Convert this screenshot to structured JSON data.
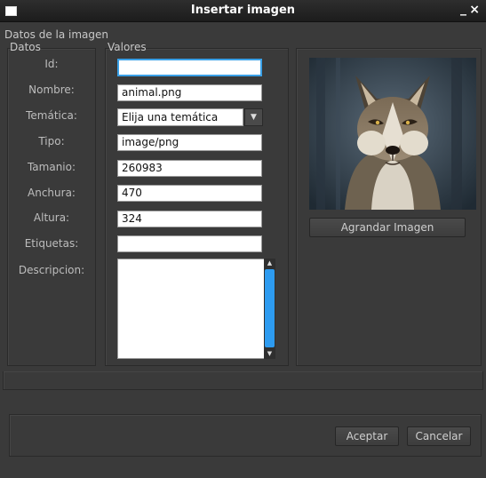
{
  "window": {
    "title": "Insertar imagen",
    "minimize_glyph": "_",
    "close_glyph": "×"
  },
  "group": {
    "title": "Datos de la imagen"
  },
  "columns": {
    "datos": "Datos",
    "valores": "Valores"
  },
  "fields": {
    "id": {
      "label": "Id:",
      "value": ""
    },
    "nombre": {
      "label": "Nombre:",
      "value": "animal.png"
    },
    "tematica": {
      "label": "Temática:",
      "value": "Elija una temática"
    },
    "tipo": {
      "label": "Tipo:",
      "value": "image/png"
    },
    "tamanio": {
      "label": "Tamanio:",
      "value": "260983"
    },
    "anchura": {
      "label": "Anchura:",
      "value": "470"
    },
    "altura": {
      "label": "Altura:",
      "value": "324"
    },
    "etiquetas": {
      "label": "Etiquetas:",
      "value": ""
    },
    "descripcion": {
      "label": "Descripcion:",
      "value": ""
    }
  },
  "preview": {
    "enlarge_button": "Agrandar Imagen",
    "image_icon": "wolf-photo"
  },
  "buttons": {
    "accept": "Aceptar",
    "cancel": "Cancelar"
  },
  "colors": {
    "accent": "#3aa0e6",
    "scroll_thumb": "#2d9bf0",
    "background": "#3a3a3a"
  }
}
